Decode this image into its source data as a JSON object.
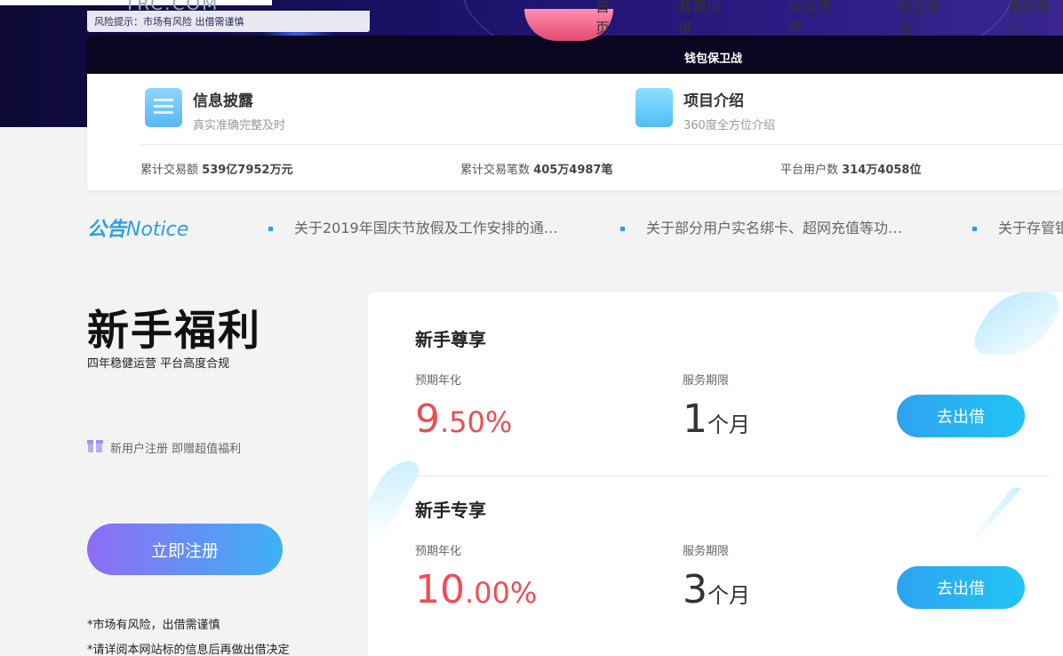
{
  "header": {
    "logo_text": "TRC.COM",
    "nav_items": [
      "首页",
      "我要出借",
      "安全保障",
      "信息披露",
      "我的账户"
    ],
    "top_notice": "风险提示：市场有风险 出借需谨慎",
    "hero_caption": "钱包保卫战"
  },
  "info_card": {
    "items": [
      {
        "title": "信息披露",
        "subtitle": "真实准确完整及时",
        "icon": "document-icon"
      },
      {
        "title": "项目介绍",
        "subtitle": "360度全方位介绍",
        "icon": "folder-icon"
      }
    ],
    "stats": [
      {
        "label": "累计交易额",
        "value": "539亿7952万元"
      },
      {
        "label": "累计交易笔数",
        "value": "405万4987笔"
      },
      {
        "label": "平台用户数",
        "value": "314万4058位"
      }
    ]
  },
  "notice": {
    "logo_cn": "公告",
    "logo_en": "Notice",
    "items": [
      "关于2019年国庆节放假及工作安排的通…",
      "关于部分用户实名绑卡、超网充值等功…",
      "关于存管银"
    ]
  },
  "promo": {
    "title": "新手福利",
    "subtitle": "四年稳健运营 平台高度合规",
    "gift_text": "新用户注册 即赠超值福利",
    "register_label": "立即注册",
    "disclaimers": [
      "*市场有风险，出借需谨慎",
      "*请详阅本网站标的信息后再做出借决定"
    ]
  },
  "products": [
    {
      "title": "新手尊享",
      "rate_label": "预期年化",
      "rate_int": "9",
      "rate_dec": ".50%",
      "term_label": "服务期限",
      "term_num": "1",
      "term_unit": "个月",
      "button_label": "去出借"
    },
    {
      "title": "新手专享",
      "rate_label": "预期年化",
      "rate_int": "10",
      "rate_dec": ".00%",
      "term_label": "服务期限",
      "term_num": "3",
      "term_unit": "个月",
      "button_label": "去出借"
    }
  ],
  "colors": {
    "accent_blue": "#2aa0e6",
    "rate_red": "#f04d53",
    "register_gradient_start": "#8f6cf5",
    "register_gradient_end": "#3db1f5"
  }
}
